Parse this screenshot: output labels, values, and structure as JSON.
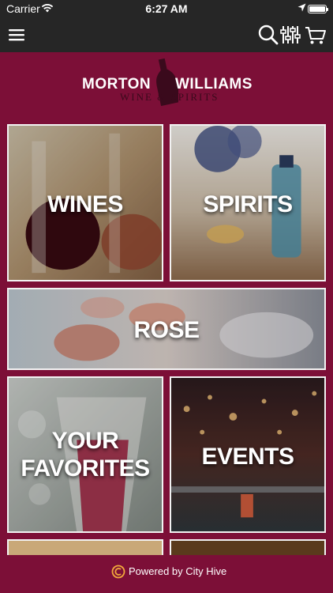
{
  "status_bar": {
    "carrier": "Carrier",
    "time": "6:27 AM"
  },
  "navbar": {
    "icons": [
      "menu-icon",
      "search-icon",
      "filter-sliders-icon",
      "cart-icon"
    ]
  },
  "logo": {
    "name_left": "MORTON",
    "name_right": "WILLIAMS",
    "subtitle": "WINE & SPIRITS"
  },
  "tiles": [
    {
      "label": "WINES"
    },
    {
      "label": "SPIRITS"
    },
    {
      "label": "ROSE"
    },
    {
      "label_line1": "YOUR",
      "label_line2": "FAVORITES"
    },
    {
      "label": "EVENTS"
    }
  ],
  "footer": {
    "powered_by": "Powered by City Hive"
  },
  "colors": {
    "background": "#7c0f37",
    "bar": "#262626",
    "tile_border": "#f2f2f2"
  }
}
